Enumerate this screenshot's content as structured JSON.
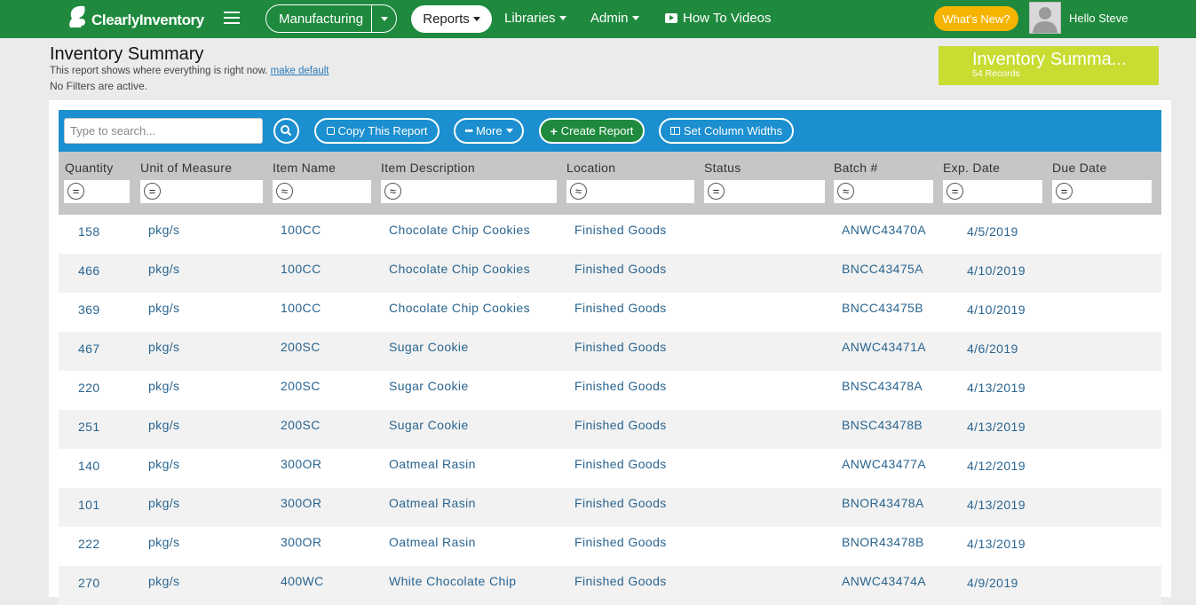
{
  "app": {
    "logo_text": "ClearlyInventory"
  },
  "nav": {
    "manufacturing": "Manufacturing",
    "reports": "Reports",
    "libraries": "Libraries",
    "admin": "Admin",
    "how_to_videos": "How To Videos",
    "whats_new": "What's New?",
    "greeting": "Hello Steve"
  },
  "page": {
    "title": "Inventory Summary",
    "subtitle": "This report shows where everything is right now.",
    "make_default": "make default",
    "filters_status": "No Filters are active."
  },
  "summary_box": {
    "title": "Inventory Summa...",
    "records": "54 Records"
  },
  "toolbar": {
    "search_placeholder": "Type to search...",
    "copy_report": "Copy This Report",
    "more": "More",
    "create_report": "Create Report",
    "set_column_widths": "Set Column Widths"
  },
  "columns": [
    {
      "label": "Quantity",
      "filter_op": "="
    },
    {
      "label": "Unit of Measure",
      "filter_op": "="
    },
    {
      "label": "Item Name",
      "filter_op": "≈"
    },
    {
      "label": "Item Description",
      "filter_op": "≈"
    },
    {
      "label": "Location",
      "filter_op": "≈"
    },
    {
      "label": "Status",
      "filter_op": "="
    },
    {
      "label": "Batch #",
      "filter_op": "≈"
    },
    {
      "label": "Exp. Date",
      "filter_op": "="
    },
    {
      "label": "Due Date",
      "filter_op": "="
    }
  ],
  "rows": [
    [
      "158",
      "pkg/s",
      "100CC",
      "Chocolate Chip Cookies",
      "Finished Goods",
      "",
      "ANWC43470A",
      "4/5/2019",
      ""
    ],
    [
      "466",
      "pkg/s",
      "100CC",
      "Chocolate Chip Cookies",
      "Finished Goods",
      "",
      "BNCC43475A",
      "4/10/2019",
      ""
    ],
    [
      "369",
      "pkg/s",
      "100CC",
      "Chocolate Chip Cookies",
      "Finished Goods",
      "",
      "BNCC43475B",
      "4/10/2019",
      ""
    ],
    [
      "467",
      "pkg/s",
      "200SC",
      "Sugar Cookie",
      "Finished Goods",
      "",
      "ANWC43471A",
      "4/6/2019",
      ""
    ],
    [
      "220",
      "pkg/s",
      "200SC",
      "Sugar Cookie",
      "Finished Goods",
      "",
      "BNSC43478A",
      "4/13/2019",
      ""
    ],
    [
      "251",
      "pkg/s",
      "200SC",
      "Sugar Cookie",
      "Finished Goods",
      "",
      "BNSC43478B",
      "4/13/2019",
      ""
    ],
    [
      "140",
      "pkg/s",
      "300OR",
      "Oatmeal Rasin",
      "Finished Goods",
      "",
      "ANWC43477A",
      "4/12/2019",
      ""
    ],
    [
      "101",
      "pkg/s",
      "300OR",
      "Oatmeal Rasin",
      "Finished Goods",
      "",
      "BNOR43478A",
      "4/13/2019",
      ""
    ],
    [
      "222",
      "pkg/s",
      "300OR",
      "Oatmeal Rasin",
      "Finished Goods",
      "",
      "BNOR43478B",
      "4/13/2019",
      ""
    ],
    [
      "270",
      "pkg/s",
      "400WC",
      "White Chocolate Chip",
      "Finished Goods",
      "",
      "ANWC43474A",
      "4/9/2019",
      ""
    ]
  ]
}
